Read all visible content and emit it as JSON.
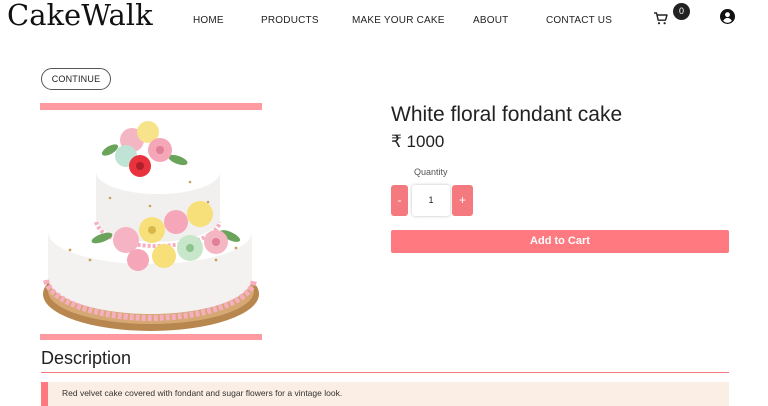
{
  "header": {
    "logo": "CakeWalk",
    "nav": [
      "HOME",
      "PRODUCTS",
      "MAKE YOUR CAKE",
      "ABOUT",
      "CONTACT US"
    ],
    "cart_count": "0"
  },
  "continue_label": "CONTINUE",
  "product": {
    "title": "White floral fondant cake",
    "price": "₹ 1000",
    "quantity_label": "Quantity",
    "quantity": "1",
    "minus_label": "-",
    "plus_label": "+",
    "add_to_cart_label": "Add to Cart"
  },
  "description": {
    "heading": "Description",
    "text": "Red velvet cake covered with fondant and sugar flowers for a vintage look."
  },
  "colors": {
    "accent": "#ff7a80",
    "image_frame": "#ff9aa0",
    "description_bg": "#fbeee4"
  }
}
